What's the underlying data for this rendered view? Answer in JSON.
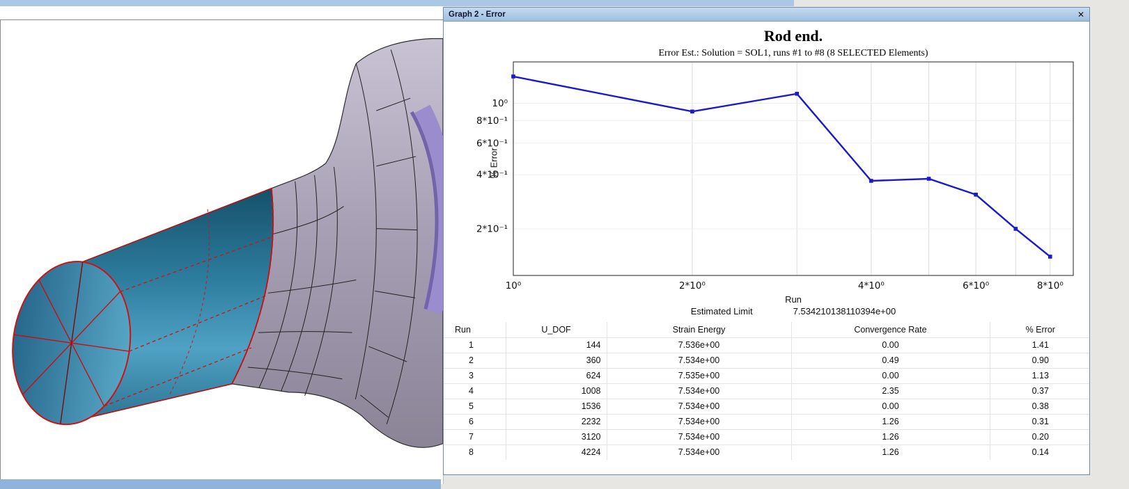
{
  "window": {
    "title": "Graph 2 - Error",
    "close_glyph": "✕"
  },
  "chart_data": {
    "type": "line",
    "title": "Rod end.",
    "subtitle": "Error Est.: Solution = SOL1, runs #1 to #8 (8 SELECTED Elements)",
    "xlabel": "Run",
    "ylabel": "% Error",
    "x_scale": "log",
    "y_scale": "log",
    "x": [
      1,
      2,
      3,
      4,
      5,
      6,
      7,
      8
    ],
    "values": [
      1.41,
      0.9,
      1.13,
      0.37,
      0.38,
      0.31,
      0.2,
      0.14
    ],
    "xlim": [
      1,
      8.75
    ],
    "ylim": [
      0.11,
      1.7
    ],
    "x_ticks": [
      {
        "v": 1,
        "label": "10⁰"
      },
      {
        "v": 2,
        "label": "2*10⁰"
      },
      {
        "v": 4,
        "label": "4*10⁰"
      },
      {
        "v": 6,
        "label": "6*10⁰"
      },
      {
        "v": 8,
        "label": "8*10⁰"
      }
    ],
    "y_ticks": [
      {
        "v": 1.0,
        "label": "10⁰"
      },
      {
        "v": 0.8,
        "label": "8*10⁻¹"
      },
      {
        "v": 0.6,
        "label": "6*10⁻¹"
      },
      {
        "v": 0.4,
        "label": "4*10⁻¹"
      },
      {
        "v": 0.2,
        "label": "2*10⁻¹"
      }
    ],
    "x_gridlines": [
      2,
      3,
      4,
      5,
      6,
      7,
      8
    ],
    "grid": true,
    "legend": "none",
    "line_color": "#1a1acc",
    "estimated_limit_label": "Estimated Limit",
    "estimated_limit_value": "7.534210138110394e+00"
  },
  "table": {
    "headers": [
      "Run",
      "U_DOF",
      "Strain Energy",
      "Convergence Rate",
      "% Error"
    ],
    "rows": [
      [
        "1",
        "144",
        "7.536e+00",
        "0.00",
        "1.41"
      ],
      [
        "2",
        "360",
        "7.534e+00",
        "0.49",
        "0.90"
      ],
      [
        "3",
        "624",
        "7.535e+00",
        "0.00",
        "1.13"
      ],
      [
        "4",
        "1008",
        "7.534e+00",
        "2.35",
        "0.37"
      ],
      [
        "5",
        "1536",
        "7.534e+00",
        "0.00",
        "0.38"
      ],
      [
        "6",
        "2232",
        "7.534e+00",
        "1.26",
        "0.31"
      ],
      [
        "7",
        "3120",
        "7.534e+00",
        "1.26",
        "0.20"
      ],
      [
        "8",
        "4224",
        "7.534e+00",
        "1.26",
        "0.14"
      ]
    ]
  },
  "model": {
    "selected_section_color": "#2e7fa2",
    "selection_mesh_color": "#cc1111",
    "body_color": "#a59eb4",
    "bore_highlight_color": "#9b8ccd",
    "mesh_color": "#222222"
  }
}
